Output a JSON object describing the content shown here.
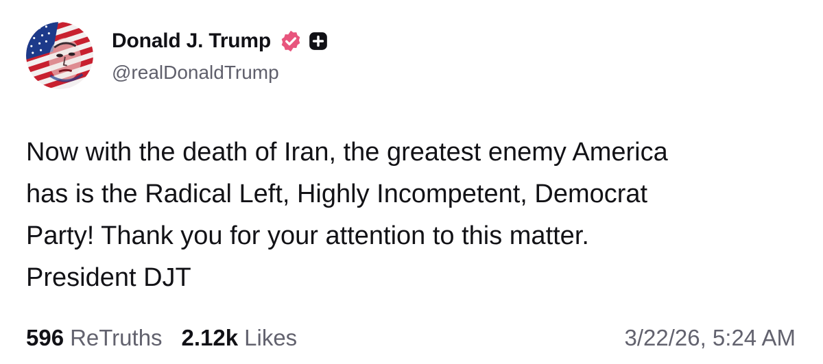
{
  "author": {
    "display_name": "Donald J. Trump",
    "handle": "@realDonaldTrump",
    "avatar_icon": "avatar-flag-portrait",
    "verified_icon": "verified-badge-icon",
    "plus_icon": "plus-badge-icon",
    "verified_color": "#e8557d",
    "plus_color": "#111116"
  },
  "post": {
    "lines": [
      "Now with the death of Iran, the greatest enemy America",
      "has is the Radical Left, Highly Incompetent, Democrat",
      "Party! Thank you for your attention to this matter.",
      "President DJT"
    ]
  },
  "stats": {
    "retruths_count": "596",
    "retruths_label": "ReTruths",
    "likes_count": "2.12k",
    "likes_label": "Likes"
  },
  "timestamp": "3/22/26, 5:24 AM"
}
